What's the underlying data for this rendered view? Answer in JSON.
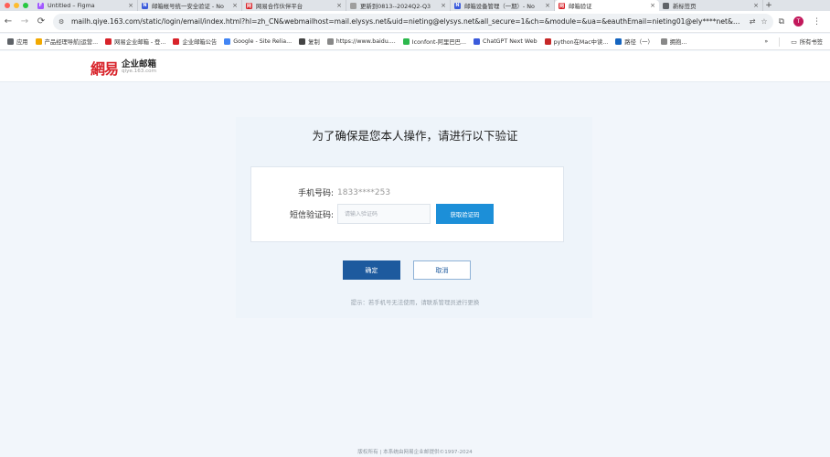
{
  "browser": {
    "tabs": [
      {
        "label": "Untitled – Figma",
        "fav_color": "#a259ff",
        "fav_glyph": "F",
        "active": false
      },
      {
        "label": "邮箱帐号统一安全验证 - No",
        "fav_color": "#3b5bdb",
        "fav_glyph": "N",
        "active": false
      },
      {
        "label": "网易合作伙伴平台",
        "fav_color": "#d8232a",
        "fav_glyph": "网",
        "active": false
      },
      {
        "label": "更新到0813--2024Q2-Q3",
        "fav_color": "#9e9e9e",
        "fav_glyph": "",
        "active": false
      },
      {
        "label": "邮箱设备管理（一期）- No",
        "fav_color": "#3b5bdb",
        "fav_glyph": "N",
        "active": false
      },
      {
        "label": "邮箱验证",
        "fav_color": "#d8232a",
        "fav_glyph": "网",
        "active": true
      },
      {
        "label": "新标签页",
        "fav_color": "#5f6368",
        "fav_glyph": "",
        "active": false
      }
    ],
    "url": "mailh.qiye.163.com/static/login/email/index.html?hl=zh_CN&webmailhost=mail.elysys.net&uid=nieting@elysys.net&all_secure=1&ch=&module=&ua=&eauthEmail=nieting01@ely****net&domain=elysys.net&a...",
    "avatar_letter": "T",
    "bookmarks": [
      {
        "label": "应用",
        "color": "#5f6368"
      },
      {
        "label": "产品经理导航|运营...",
        "color": "#f2a900"
      },
      {
        "label": "网易企业邮箱 - 登...",
        "color": "#d8232a"
      },
      {
        "label": "企业邮箱公告",
        "color": "#d8232a"
      },
      {
        "label": "Google - Site Relia...",
        "color": "#4285f4"
      },
      {
        "label": "复制",
        "color": "#444444"
      },
      {
        "label": "https://www.baidu....",
        "color": "#888888"
      },
      {
        "label": "Iconfont-阿里巴巴...",
        "color": "#2db84d"
      },
      {
        "label": "ChatGPT Next Web",
        "color": "#3b5bdb"
      },
      {
        "label": "python在Mac中读...",
        "color": "#c62828"
      },
      {
        "label": "路径（一）",
        "color": "#1565c0"
      },
      {
        "label": "拥抱...",
        "color": "#888888"
      }
    ],
    "bookmarks_more": "»",
    "all_bookmarks": "所有书签"
  },
  "header": {
    "logo_mark": "網易",
    "logo_cn": "企业邮箱",
    "logo_domain": "qiye.163.com"
  },
  "verify": {
    "title": "为了确保是您本人操作，请进行以下验证",
    "phone_label": "手机号码:",
    "phone_value": "1833****253",
    "code_label": "短信验证码:",
    "code_placeholder": "请输入验证码",
    "get_code_label": "获取验证码",
    "confirm_label": "确定",
    "cancel_label": "取消",
    "hint": "提示：若手机号无法使用，请联系管理员进行更换"
  },
  "footer": {
    "text": "版权所有 | 本系统由网易企业邮提供©1997-2024"
  }
}
